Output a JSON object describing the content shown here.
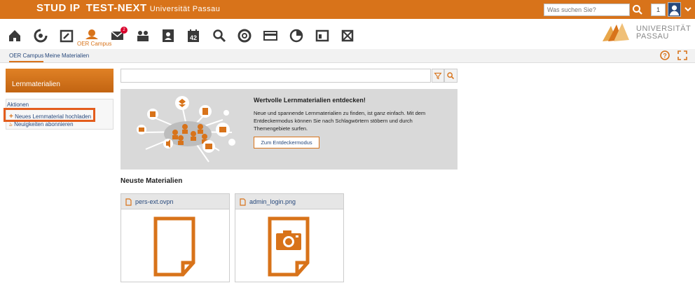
{
  "header": {
    "brand": "STUD IP",
    "instance": "TEST-NEXT",
    "university": "Universität Passau",
    "search_placeholder": "Was suchen Sie?",
    "count": "1"
  },
  "nav": {
    "icons": [
      "home-icon",
      "activity-icon",
      "courses-icon",
      "oer-campus-icon",
      "messages-icon",
      "community-icon",
      "profile-icon",
      "calendar-icon",
      "search-icon",
      "lifebuoy-icon",
      "card-icon",
      "stats-icon",
      "admin-icon",
      "tools-icon"
    ],
    "active_label": "OER Campus",
    "messages_badge": "2",
    "calendar_day": "42",
    "logo_line1": "UNIVERSITÄT",
    "logo_line2": "PASSAU"
  },
  "tabs": [
    {
      "label": "OER Campus",
      "active": true
    },
    {
      "label": "Meine Materialien",
      "active": false
    }
  ],
  "sidebar": {
    "title": "Lernmaterialien",
    "section": "Aktionen",
    "items": [
      {
        "label": "Neues Lernmaterial hochladen",
        "icon": "plus-icon"
      },
      {
        "label": "Neuigkeiten abonnieren",
        "icon": "rss-icon"
      }
    ]
  },
  "hero": {
    "title": "Wertvolle Lernmaterialien entdecken!",
    "text": "Neue und spannende Lernmaterialien zu finden, ist ganz einfach. Mit dem Entdeckermodus können Sie nach Schlagwörtern stöbern und durch Themengebiete surfen.",
    "button": "Zum Entdeckermodus"
  },
  "materials": {
    "title": "Neuste Materialien",
    "items": [
      {
        "name": "pers-ext.ovpn",
        "type": "file"
      },
      {
        "name": "admin_login.png",
        "type": "image"
      }
    ]
  },
  "colors": {
    "accent": "#d8731a",
    "link": "#28497c",
    "highlight": "#e35d1d"
  }
}
